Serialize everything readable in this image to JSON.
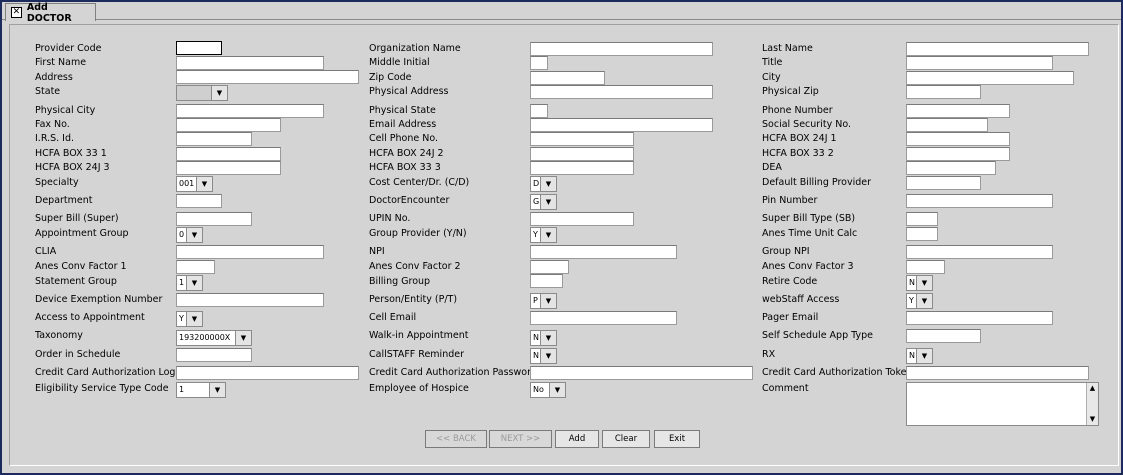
{
  "window": {
    "tab_title": "Add DOCTOR",
    "close_glyph": "✕"
  },
  "icons": {
    "combo_arrow": "▼",
    "scroll_up": "▲",
    "scroll_down": "▼"
  },
  "labels": {
    "provider_code": "Provider Code",
    "first_name": "First Name",
    "address": "Address",
    "state": "State",
    "physical_city": "Physical City",
    "fax_no": "Fax No.",
    "irs_id": "I.R.S. Id.",
    "hcfa_33_1": "HCFA BOX 33 1",
    "hcfa_24j_3": "HCFA BOX 24J 3",
    "specialty": "Specialty",
    "department": "Department",
    "super_bill": "Super Bill (Super)",
    "appointment_group": "Appointment Group",
    "clia": "CLIA",
    "anes_conv_1": "Anes Conv Factor 1",
    "statement_group": "Statement Group",
    "device_exemption": "Device Exemption Number",
    "access_to_appt": "Access to Appointment",
    "taxonomy": "Taxonomy",
    "order_in_schedule": "Order in Schedule",
    "cc_auth_login": "Credit Card Authorization Login",
    "eligibility_service": "Eligibility Service Type Code",
    "organization_name": "Organization Name",
    "middle_initial": "Middle Initial",
    "zip_code": "Zip Code",
    "physical_address": "Physical Address",
    "physical_state": "Physical State",
    "email_address": "Email Address",
    "cell_phone": "Cell Phone No.",
    "hcfa_24j_2": "HCFA BOX 24J 2",
    "hcfa_33_3": "HCFA BOX 33 3",
    "cost_center": "Cost Center/Dr.  (C/D)",
    "doctor_encounter": "DoctorEncounter",
    "upin": "UPIN No.",
    "group_provider": "Group Provider (Y/N)",
    "npi": "NPI",
    "anes_conv_2": "Anes Conv Factor 2",
    "billing_group": "Billing Group",
    "person_entity": "Person/Entity (P/T)",
    "cell_email": "Cell Email",
    "walk_in": "Walk-in Appointment",
    "callstaff": "CallSTAFF Reminder",
    "cc_auth_password": "Credit Card Authorization Password",
    "employee_hospice": "Employee of Hospice",
    "last_name": "Last Name",
    "title": "Title",
    "city": "City",
    "physical_zip": "Physical Zip",
    "phone_number": "Phone Number",
    "ssn": "Social Security No.",
    "hcfa_24j_1": "HCFA BOX 24J 1",
    "hcfa_33_2": "HCFA BOX 33 2",
    "dea": "DEA",
    "default_billing": "Default Billing Provider",
    "pin_number": "Pin Number",
    "super_bill_type": "Super Bill Type (SB)",
    "anes_time_unit": "Anes Time Unit Calc",
    "group_npi": "Group NPI",
    "anes_conv_3": "Anes Conv Factor 3",
    "retire_code": "Retire Code",
    "webstaff": "webStaff Access",
    "pager_email": "Pager Email",
    "self_schedule": "Self Schedule App Type",
    "rx": "RX",
    "cc_auth_token": "Credit Card Authorization Token",
    "comment": "Comment"
  },
  "combos": {
    "state": "",
    "specialty": "001",
    "appointment_group": "0",
    "statement_group": "1",
    "access_to_appt": "Y",
    "taxonomy": "193200000X",
    "eligibility_service": "1",
    "cost_center": "D",
    "doctor_encounter": "G",
    "group_provider": "Y",
    "person_entity": "P",
    "walk_in": "N",
    "callstaff": "N",
    "employee_hospice": "No",
    "retire_code": "N",
    "webstaff": "Y",
    "rx": "N"
  },
  "buttons": {
    "back": "<< BACK",
    "next": "NEXT >>",
    "add": "Add",
    "clear": "Clear",
    "exit": "Exit"
  }
}
